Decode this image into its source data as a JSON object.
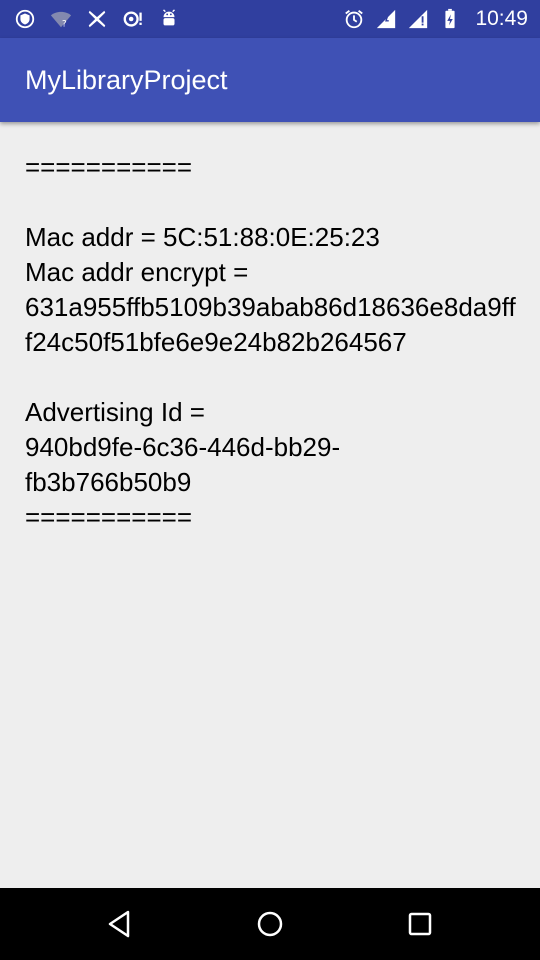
{
  "status_bar": {
    "time": "10:49",
    "left_icons": [
      "vpn-shield-icon",
      "wifi-unknown-icon",
      "close-x-icon",
      "sync-alert-icon",
      "android-debug-icon"
    ],
    "right_icons": [
      "alarm-icon",
      "signal-icon",
      "signal-icon-2",
      "battery-charging-icon"
    ]
  },
  "app_bar": {
    "title": "MyLibraryProject"
  },
  "content": {
    "separator_top": "===========",
    "mac_addr": "Mac addr = 5C:51:88:0E:25:23",
    "mac_encrypt_label": "Mac addr encrypt =",
    "mac_encrypt_value": "631a955ffb5109b39abab86d18636e8da9fff24c50f51bfe6e9e24b82b264567",
    "advertising_label": "Advertising Id =",
    "advertising_value_line1": "940bd9fe-6c36-446d-bb29-",
    "advertising_value_line2": "fb3b766b50b9",
    "separator_bottom": "==========="
  },
  "nav_bar": {
    "icons": [
      "back-icon",
      "home-icon",
      "recents-icon"
    ]
  },
  "colors": {
    "status_bar": "#303f9f",
    "app_bar": "#3f51b5",
    "background": "#eeeeee",
    "nav_bar": "#000000"
  }
}
